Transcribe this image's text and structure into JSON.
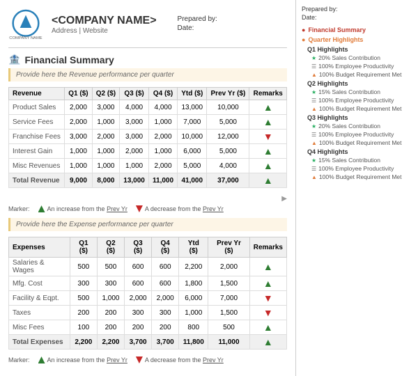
{
  "header": {
    "company_name": "<COMPANY NAME>",
    "address": "Address | Website",
    "prepared_by_label": "Prepared by:",
    "date_label": "Date:"
  },
  "main": {
    "section_title": "Financial Summary",
    "revenue_note": "Provide here the Revenue performance per quarter",
    "revenue_table": {
      "headers": [
        "Revenue",
        "Q1 ($)",
        "Q2 ($)",
        "Q3 ($)",
        "Q4 ($)",
        "Ytd ($)",
        "Prev Yr ($)",
        "Remarks"
      ],
      "rows": [
        {
          "label": "Product Sales",
          "q1": "2,000",
          "q2": "3,000",
          "q3": "4,000",
          "q4": "4,000",
          "ytd": "13,000",
          "prev": "10,000",
          "trend": "up"
        },
        {
          "label": "Service Fees",
          "q1": "2,000",
          "q2": "1,000",
          "q3": "3,000",
          "q4": "1,000",
          "ytd": "7,000",
          "prev": "5,000",
          "trend": "up"
        },
        {
          "label": "Franchise Fees",
          "q1": "3,000",
          "q2": "2,000",
          "q3": "3,000",
          "q4": "2,000",
          "ytd": "10,000",
          "prev": "12,000",
          "trend": "down"
        },
        {
          "label": "Interest Gain",
          "q1": "1,000",
          "q2": "1,000",
          "q3": "2,000",
          "q4": "1,000",
          "ytd": "6,000",
          "prev": "5,000",
          "trend": "up"
        },
        {
          "label": "Misc Revenues",
          "q1": "1,000",
          "q2": "1,000",
          "q3": "1,000",
          "q4": "2,000",
          "ytd": "5,000",
          "prev": "4,000",
          "trend": "up"
        },
        {
          "label": "Total Revenue",
          "q1": "9,000",
          "q2": "8,000",
          "q3": "13,000",
          "q4": "11,000",
          "ytd": "41,000",
          "prev": "37,000",
          "trend": "up",
          "total": true
        }
      ]
    },
    "marker": {
      "label": "Marker:",
      "up_text": "An increase from the Prev Yr",
      "down_text": "A decrease from the Prev Yr"
    },
    "expense_note": "Provide here the Expense performance per quarter",
    "expense_table": {
      "headers": [
        "Expenses",
        "Q1 ($)",
        "Q2 ($)",
        "Q3 ($)",
        "Q4 ($)",
        "Ytd ($)",
        "Prev Yr ($)",
        "Remarks"
      ],
      "rows": [
        {
          "label": "Salaries & Wages",
          "q1": "500",
          "q2": "500",
          "q3": "600",
          "q4": "600",
          "ytd": "2,200",
          "prev": "2,000",
          "trend": "up"
        },
        {
          "label": "Mfg. Cost",
          "q1": "300",
          "q2": "300",
          "q3": "600",
          "q4": "600",
          "ytd": "1,800",
          "prev": "1,500",
          "trend": "up"
        },
        {
          "label": "Facility & Eqpt.",
          "q1": "500",
          "q2": "1,000",
          "q3": "2,000",
          "q4": "2,000",
          "ytd": "6,000",
          "prev": "7,000",
          "trend": "down"
        },
        {
          "label": "Taxes",
          "q1": "200",
          "q2": "200",
          "q3": "300",
          "q4": "300",
          "ytd": "1,000",
          "prev": "1,500",
          "trend": "down"
        },
        {
          "label": "Misc Fees",
          "q1": "100",
          "q2": "200",
          "q3": "200",
          "q4": "200",
          "ytd": "800",
          "prev": "500",
          "trend": "up"
        },
        {
          "label": "Total Expenses",
          "q1": "2,200",
          "q2": "2,200",
          "q3": "3,700",
          "q4": "3,700",
          "ytd": "11,800",
          "prev": "11,000",
          "trend": "up",
          "total": true
        }
      ]
    }
  },
  "sidebar": {
    "prepared_by": "Prepared by:",
    "date": "Date:",
    "nav_items": [
      {
        "label": "Financial Summary",
        "type": "active"
      },
      {
        "label": "Quarter Highlights",
        "type": "section"
      },
      {
        "label": "Q1 Highlights",
        "type": "subsection"
      },
      {
        "label": "20% Sales Contribution",
        "type": "highlight",
        "color": "green"
      },
      {
        "label": "100% Employee Productivity",
        "type": "highlight",
        "color": "gray"
      },
      {
        "label": "100% Budget Requirement Met",
        "type": "highlight",
        "color": "orange"
      },
      {
        "label": "Q2 Highlights",
        "type": "subsection"
      },
      {
        "label": "15% Sales Contribution",
        "type": "highlight",
        "color": "green"
      },
      {
        "label": "100% Employee Productivity",
        "type": "highlight",
        "color": "gray"
      },
      {
        "label": "100% Budget Requirement Met",
        "type": "highlight",
        "color": "orange"
      },
      {
        "label": "Q3 Highlights",
        "type": "subsection"
      },
      {
        "label": "20% Sales Contribution",
        "type": "highlight",
        "color": "green"
      },
      {
        "label": "100% Employee Productivity",
        "type": "highlight",
        "color": "gray"
      },
      {
        "label": "100% Budget Requirement Met",
        "type": "highlight",
        "color": "orange"
      },
      {
        "label": "Q4 Highlights",
        "type": "subsection"
      },
      {
        "label": "15% Sales Contribution",
        "type": "highlight",
        "color": "green"
      },
      {
        "label": "100% Employee Productivity",
        "type": "highlight",
        "color": "gray"
      },
      {
        "label": "100% Budget Requirement Met",
        "type": "highlight",
        "color": "orange"
      }
    ]
  }
}
